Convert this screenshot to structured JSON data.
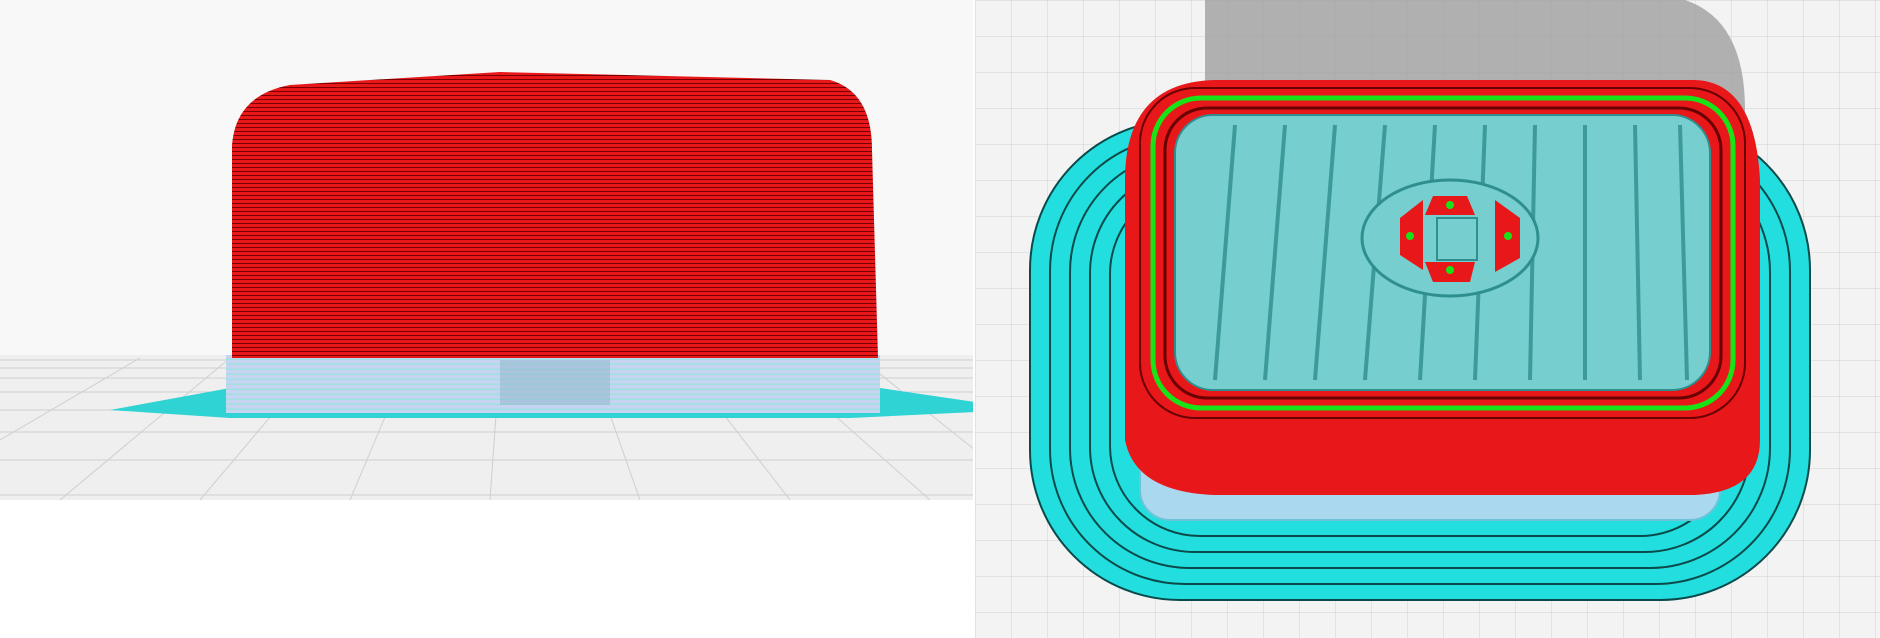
{
  "views": [
    {
      "view": "side",
      "colors": {
        "background": "#f7f7f7",
        "build_plate_grid": "#c9c9c9",
        "wall": "#e8181a",
        "layer_line": "#6a0000",
        "support": "#b9c9ee",
        "brim": "#2fd3d3"
      }
    },
    {
      "view": "perspective",
      "colors": {
        "background": "#f3f3f3",
        "build_plate_grid": "#d2d2d2",
        "wall": "#e8181a",
        "inner_wall": "#17e317",
        "infill": "#76cece",
        "brim": "#20e0e0",
        "shadow": "#a0a0a0"
      }
    }
  ]
}
